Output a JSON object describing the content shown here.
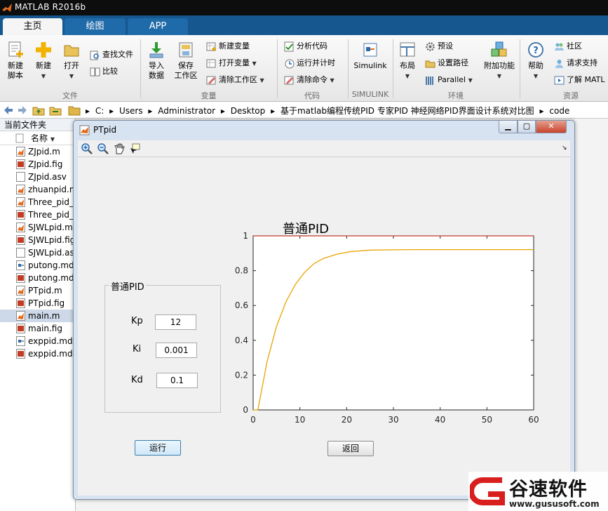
{
  "app": {
    "title": "MATLAB R2016b"
  },
  "tabs": [
    {
      "label": "主页"
    },
    {
      "label": "绘图"
    },
    {
      "label": "APP"
    }
  ],
  "ribbon": {
    "new_script": "新建\n脚本",
    "new": "新建",
    "open": "打开",
    "find_files": "查找文件",
    "compare": "比较",
    "import_data": "导入\n数据",
    "save_workspace": "保存\n工作区",
    "new_variable": "新建变量",
    "open_variable": "打开变量",
    "clear_workspace": "清除工作区",
    "analyze_code": "分析代码",
    "run_and_time": "运行并计时",
    "clear_commands": "清除命令",
    "simulink": "Simulink",
    "layout": "布局",
    "preferences": "预设",
    "set_path": "设置路径",
    "parallel": "Parallel",
    "add_ons": "附加功能",
    "help": "帮助",
    "community": "社区",
    "request_support": "请求支持",
    "learn_matlab": "了解 MATL",
    "groups": {
      "file": "文件",
      "variable": "变量",
      "code": "代码",
      "simulink": "SIMULINK",
      "environment": "环境",
      "resources": "资源"
    }
  },
  "address": {
    "crumbs": [
      "C:",
      "Users",
      "Administrator",
      "Desktop",
      "基于matlab编程传统PID 专家PID 神经网络PID界面设计系统对比图",
      "code"
    ]
  },
  "current_folder": {
    "title": "当前文件夹",
    "name_header": "名称",
    "files": [
      {
        "name": "ZJpid.m",
        "type": "m"
      },
      {
        "name": "ZJpid.fig",
        "type": "fig"
      },
      {
        "name": "ZJpid.asv",
        "type": "asv"
      },
      {
        "name": "zhuanpid.m",
        "type": "m"
      },
      {
        "name": "Three_pid_",
        "type": "m"
      },
      {
        "name": "Three_pid_",
        "type": "fig"
      },
      {
        "name": "SJWLpid.m",
        "type": "m"
      },
      {
        "name": "SJWLpid.fig",
        "type": "fig"
      },
      {
        "name": "SJWLpid.as",
        "type": "asv"
      },
      {
        "name": "putong.md",
        "type": "mdl"
      },
      {
        "name": "putong.md",
        "type": "fig"
      },
      {
        "name": "PTpid.m",
        "type": "m"
      },
      {
        "name": "PTpid.fig",
        "type": "fig"
      },
      {
        "name": "main.m",
        "type": "m",
        "selected": true
      },
      {
        "name": "main.fig",
        "type": "fig"
      },
      {
        "name": "exppid.md",
        "type": "mdl"
      },
      {
        "name": "exppid.md",
        "type": "fig"
      }
    ]
  },
  "figure": {
    "title": "PTpid",
    "plot_title": "普通PID",
    "group_title": "普通PID",
    "params": [
      {
        "label": "Kp",
        "value": "12"
      },
      {
        "label": "Ki",
        "value": "0.001"
      },
      {
        "label": "Kd",
        "value": "0.1"
      }
    ],
    "run_label": "运行",
    "back_label": "返回"
  },
  "chart_data": {
    "type": "line",
    "title": "",
    "xlabel": "",
    "ylabel": "",
    "xlim": [
      0,
      60
    ],
    "ylim": [
      0,
      1
    ],
    "xticks": [
      0,
      10,
      20,
      30,
      40,
      50,
      60
    ],
    "yticks": [
      0,
      0.2,
      0.4,
      0.6,
      0.8,
      1
    ],
    "grid": false,
    "series": [
      {
        "x": [
          0,
          1,
          3,
          5,
          7,
          9,
          11,
          13,
          15,
          18,
          21,
          25,
          30,
          35,
          40,
          50,
          60
        ],
        "y": [
          0,
          0,
          0.28,
          0.48,
          0.62,
          0.72,
          0.79,
          0.84,
          0.87,
          0.895,
          0.91,
          0.918,
          0.92,
          0.921,
          0.921,
          0.921,
          0.921
        ],
        "color": "#e8a400"
      },
      {
        "x": [
          0,
          60
        ],
        "y": [
          1,
          1
        ],
        "color": "#c0392b"
      }
    ]
  },
  "watermark": {
    "text": "谷速软件",
    "url": "www.gususoft.com"
  }
}
